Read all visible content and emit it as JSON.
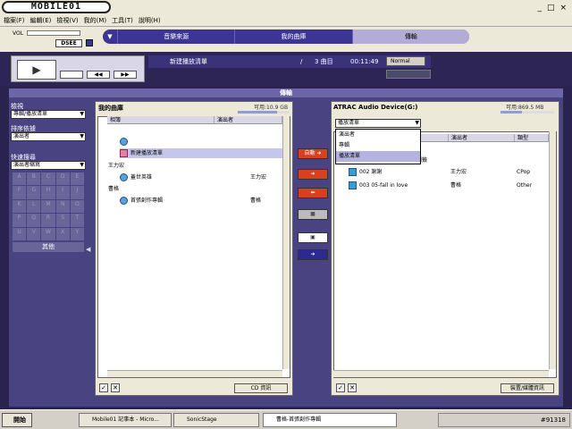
{
  "window": {
    "logo": "MOBILE01",
    "menu": [
      "檔案(F)",
      "編輯(E)",
      "檢視(V)",
      "我的(M)",
      "工具(T)",
      "說明(H)"
    ],
    "controls": [
      "_",
      "□",
      "×"
    ]
  },
  "header": {
    "volume_label": "VOL",
    "dsee_label": "DSEE",
    "modes": [
      {
        "label": "音樂來源",
        "active": false
      },
      {
        "label": "我的曲庫",
        "active": false
      },
      {
        "label": "傳輸",
        "active": true
      }
    ],
    "arrow_left": "▼",
    "arrow_right": "▼"
  },
  "player": {
    "play_icon": "▶",
    "prev_icon": "◀◀",
    "next_icon": "▶▶",
    "playlist_name": "新建播放清單",
    "separator": "/",
    "track_count": "3 曲目",
    "time": "00:11:49",
    "mode": "Normal"
  },
  "section_title": "傳輸",
  "left_controls": {
    "search_label": "檢視",
    "search_value": "專輯/播放清單",
    "sort_label": "排序依據",
    "sort_value": "演出者",
    "quick_label": "快速搜尋",
    "quick_value": "演出者縮寫",
    "letters": [
      "A",
      "B",
      "C",
      "D",
      "E",
      "F",
      "G",
      "H",
      "I",
      "J",
      "K",
      "L",
      "M",
      "N",
      "O",
      "P",
      "Q",
      "R",
      "S",
      "T",
      "U",
      "V",
      "W",
      "X",
      "Y"
    ],
    "other_label": "其他",
    "collapse_icon": "◀"
  },
  "library": {
    "title": "我的曲庫",
    "capacity": "可用:10.9 GB",
    "capacity_fill": 0.75,
    "columns": [
      "相簿",
      "演出者"
    ],
    "rows": [
      {
        "group": "",
        "name": "",
        "artist": "",
        "icon": "disc-icon"
      },
      {
        "group": "",
        "name": "新建播放清單",
        "artist": "",
        "icon": "playlist-icon",
        "selected": true
      },
      {
        "group": "王力宏",
        "name": "蓋世英雄",
        "artist": "王力宏",
        "icon": "disc-icon"
      },
      {
        "group": "曹格",
        "name": "首張創作專輯",
        "artist": "曹格",
        "icon": "disc-icon"
      }
    ],
    "cd_button": "CD 資訊"
  },
  "transfer_buttons": {
    "auto": "自動 ➜",
    "to_device": "➜",
    "to_library": "⬅",
    "stop": "■",
    "device_icon": "▣",
    "next": "➜"
  },
  "device": {
    "title": "ATRAC Audio Device(G:)",
    "capacity": "可用:869.5 MB",
    "capacity_fill": 0.4,
    "dropdown_value": "播放清單",
    "dropdown_options": [
      "演出者",
      "專輯",
      "播放清單"
    ],
    "dropdown_highlight": 2,
    "columns": [
      "",
      "演出者",
      "類型"
    ],
    "header_row_text": "標籤",
    "tracks": [
      {
        "title": "002 謝謝",
        "artist": "王力宏",
        "genre": "CPop"
      },
      {
        "title": "003 05-fall in love",
        "artist": "曹格",
        "genre": "Other"
      }
    ],
    "info_button": "裝置/媒體資訊"
  },
  "taskbar": {
    "start": "開始",
    "tasks": [
      {
        "label": "Mobile01 記事本 - Micro...",
        "active": false
      },
      {
        "label": "SonicStage",
        "active": false
      },
      {
        "label": "曹格-首張創作專輯",
        "active": true
      }
    ],
    "tray": "#91318"
  }
}
